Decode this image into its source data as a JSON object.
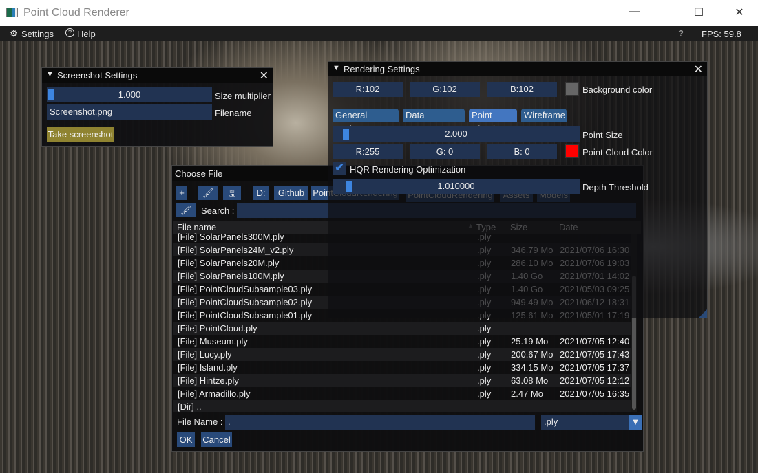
{
  "app": {
    "title": "Point Cloud Renderer",
    "minimize": "—",
    "maximize": "☐",
    "close": "✕"
  },
  "menu": {
    "settings": "Settings",
    "help": "Help",
    "help_q": "?",
    "fps": "FPS: 59.8"
  },
  "screenshot": {
    "title": "Screenshot Settings",
    "size_value": "1.000",
    "size_label": "Size multiplier",
    "size_fraction": 0.0,
    "filename": "Screenshot.png",
    "filename_label": "Filename",
    "take": "Take screenshot",
    "take_color": "#8f8331"
  },
  "rendering": {
    "title": "Rendering Settings",
    "bg": {
      "r": "R:102",
      "g": "G:102",
      "b": "B:102",
      "label": "Background color",
      "color": "#666666"
    },
    "tabs": [
      {
        "label": "General settings"
      },
      {
        "label": "Data Structures"
      },
      {
        "label": "Point Cloud",
        "active": true
      },
      {
        "label": "Wireframe"
      }
    ],
    "point_size": {
      "value": "2.000",
      "label": "Point Size"
    },
    "pc_color": {
      "r": "R:255",
      "g": "G:  0",
      "b": "B:  0",
      "label": "Point Cloud Color",
      "color": "#ff0000"
    },
    "hqr": {
      "label": "HQR Rendering Optimization",
      "checked": true
    },
    "depth": {
      "value": "1.010000",
      "label": "Depth Threshold"
    }
  },
  "file": {
    "title": "Choose File",
    "plus": "+",
    "path": [
      "D:",
      "Github",
      "PointCloudRendering",
      "PointCloudRendering",
      "Assets",
      "Models"
    ],
    "search_label": "Search :",
    "search_value": "",
    "headers": {
      "name": "File name",
      "type": "Type",
      "size": "Size",
      "date": "Date"
    },
    "rows": [
      {
        "name": "[File] SolarPanels300M.ply",
        "type": ".ply",
        "size": "",
        "date": ""
      },
      {
        "name": "[File] SolarPanels24M_v2.ply",
        "type": ".ply",
        "size": "346.79 Mo",
        "date": "2021/07/06 16:30"
      },
      {
        "name": "[File] SolarPanels20M.ply",
        "type": ".ply",
        "size": "286.10 Mo",
        "date": "2021/07/06 19:03"
      },
      {
        "name": "[File] SolarPanels100M.ply",
        "type": ".ply",
        "size": "1.40 Go",
        "date": "2021/07/01 14:02"
      },
      {
        "name": "[File] PointCloudSubsample03.ply",
        "type": ".ply",
        "size": "1.40 Go",
        "date": "2021/05/03 09:25"
      },
      {
        "name": "[File] PointCloudSubsample02.ply",
        "type": ".ply",
        "size": "949.49 Mo",
        "date": "2021/06/12 18:31"
      },
      {
        "name": "[File] PointCloudSubsample01.ply",
        "type": ".ply",
        "size": "125.61 Mo",
        "date": "2021/05/01 17:19"
      },
      {
        "name": "[File] PointCloud.ply",
        "type": ".ply",
        "size": "",
        "date": ""
      },
      {
        "name": "[File] Museum.ply",
        "type": ".ply",
        "size": "25.19 Mo",
        "date": "2021/07/05 12:40"
      },
      {
        "name": "[File] Lucy.ply",
        "type": ".ply",
        "size": "200.67 Mo",
        "date": "2021/07/05 17:43"
      },
      {
        "name": "[File] Island.ply",
        "type": ".ply",
        "size": "334.15 Mo",
        "date": "2021/07/05 17:37"
      },
      {
        "name": "[File] Hintze.ply",
        "type": ".ply",
        "size": "63.08 Mo",
        "date": "2021/07/05 12:12"
      },
      {
        "name": "[File] Armadillo.ply",
        "type": ".ply",
        "size": "2.47 Mo",
        "date": "2021/07/05 16:35"
      },
      {
        "name": "[Dir] ..",
        "type": "",
        "size": "",
        "date": ""
      }
    ],
    "filename_label": "File Name :",
    "filename_value": ".",
    "filter": ".ply",
    "ok": "OK",
    "cancel": "Cancel"
  }
}
